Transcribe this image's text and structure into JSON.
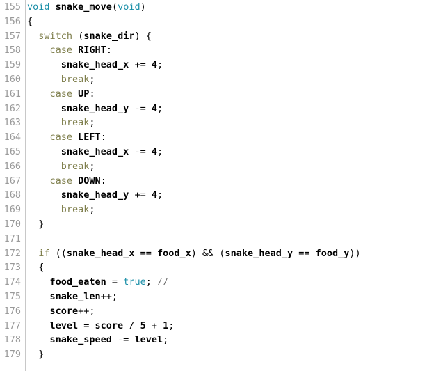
{
  "editor": {
    "language": "c",
    "background_color": "#ffffff",
    "gutter_rule_color": "#c8c8c8",
    "line_number_color": "#9a9a9a",
    "first_line_number": 155,
    "last_line_number": 179,
    "colors": {
      "keyword": "#7f7f4d",
      "type": "#1a8fa8",
      "plain": "#000000",
      "comment": "#6e6e6e"
    }
  },
  "lines": [
    {
      "number": "155",
      "tokens": [
        {
          "t": "void",
          "c": "tok-type"
        },
        {
          "t": " ",
          "c": "tok-punct"
        },
        {
          "t": "snake_move",
          "c": "tok-plain"
        },
        {
          "t": "(",
          "c": "tok-punct"
        },
        {
          "t": "void",
          "c": "tok-type"
        },
        {
          "t": ")",
          "c": "tok-punct"
        }
      ]
    },
    {
      "number": "156",
      "tokens": [
        {
          "t": "{",
          "c": "tok-punct"
        }
      ]
    },
    {
      "number": "157",
      "tokens": [
        {
          "t": "  ",
          "c": "tok-punct"
        },
        {
          "t": "switch",
          "c": "tok-keyword"
        },
        {
          "t": " ",
          "c": "tok-punct"
        },
        {
          "t": "(",
          "c": "tok-punct"
        },
        {
          "t": "snake_dir",
          "c": "tok-plain"
        },
        {
          "t": ") {",
          "c": "tok-punct"
        }
      ]
    },
    {
      "number": "158",
      "tokens": [
        {
          "t": "    ",
          "c": "tok-punct"
        },
        {
          "t": "case",
          "c": "tok-keyword"
        },
        {
          "t": " ",
          "c": "tok-punct"
        },
        {
          "t": "RIGHT",
          "c": "tok-plain"
        },
        {
          "t": ":",
          "c": "tok-punct"
        }
      ]
    },
    {
      "number": "159",
      "tokens": [
        {
          "t": "      ",
          "c": "tok-punct"
        },
        {
          "t": "snake_head_x",
          "c": "tok-plain"
        },
        {
          "t": " ",
          "c": "tok-punct"
        },
        {
          "t": "+=",
          "c": "tok-punct"
        },
        {
          "t": " ",
          "c": "tok-punct"
        },
        {
          "t": "4",
          "c": "tok-number"
        },
        {
          "t": ";",
          "c": "tok-punct"
        }
      ]
    },
    {
      "number": "160",
      "tokens": [
        {
          "t": "      ",
          "c": "tok-punct"
        },
        {
          "t": "break",
          "c": "tok-keyword"
        },
        {
          "t": ";",
          "c": "tok-punct"
        }
      ]
    },
    {
      "number": "161",
      "tokens": [
        {
          "t": "    ",
          "c": "tok-punct"
        },
        {
          "t": "case",
          "c": "tok-keyword"
        },
        {
          "t": " ",
          "c": "tok-punct"
        },
        {
          "t": "UP",
          "c": "tok-plain"
        },
        {
          "t": ":",
          "c": "tok-punct"
        }
      ]
    },
    {
      "number": "162",
      "tokens": [
        {
          "t": "      ",
          "c": "tok-punct"
        },
        {
          "t": "snake_head_y",
          "c": "tok-plain"
        },
        {
          "t": " ",
          "c": "tok-punct"
        },
        {
          "t": "-=",
          "c": "tok-punct"
        },
        {
          "t": " ",
          "c": "tok-punct"
        },
        {
          "t": "4",
          "c": "tok-number"
        },
        {
          "t": ";",
          "c": "tok-punct"
        }
      ]
    },
    {
      "number": "163",
      "tokens": [
        {
          "t": "      ",
          "c": "tok-punct"
        },
        {
          "t": "break",
          "c": "tok-keyword"
        },
        {
          "t": ";",
          "c": "tok-punct"
        }
      ]
    },
    {
      "number": "164",
      "tokens": [
        {
          "t": "    ",
          "c": "tok-punct"
        },
        {
          "t": "case",
          "c": "tok-keyword"
        },
        {
          "t": " ",
          "c": "tok-punct"
        },
        {
          "t": "LEFT",
          "c": "tok-plain"
        },
        {
          "t": ":",
          "c": "tok-punct"
        }
      ]
    },
    {
      "number": "165",
      "tokens": [
        {
          "t": "      ",
          "c": "tok-punct"
        },
        {
          "t": "snake_head_x",
          "c": "tok-plain"
        },
        {
          "t": " ",
          "c": "tok-punct"
        },
        {
          "t": "-=",
          "c": "tok-punct"
        },
        {
          "t": " ",
          "c": "tok-punct"
        },
        {
          "t": "4",
          "c": "tok-number"
        },
        {
          "t": ";",
          "c": "tok-punct"
        }
      ]
    },
    {
      "number": "166",
      "tokens": [
        {
          "t": "      ",
          "c": "tok-punct"
        },
        {
          "t": "break",
          "c": "tok-keyword"
        },
        {
          "t": ";",
          "c": "tok-punct"
        }
      ]
    },
    {
      "number": "167",
      "tokens": [
        {
          "t": "    ",
          "c": "tok-punct"
        },
        {
          "t": "case",
          "c": "tok-keyword"
        },
        {
          "t": " ",
          "c": "tok-punct"
        },
        {
          "t": "DOWN",
          "c": "tok-plain"
        },
        {
          "t": ":",
          "c": "tok-punct"
        }
      ]
    },
    {
      "number": "168",
      "tokens": [
        {
          "t": "      ",
          "c": "tok-punct"
        },
        {
          "t": "snake_head_y",
          "c": "tok-plain"
        },
        {
          "t": " ",
          "c": "tok-punct"
        },
        {
          "t": "+=",
          "c": "tok-punct"
        },
        {
          "t": " ",
          "c": "tok-punct"
        },
        {
          "t": "4",
          "c": "tok-number"
        },
        {
          "t": ";",
          "c": "tok-punct"
        }
      ]
    },
    {
      "number": "169",
      "tokens": [
        {
          "t": "      ",
          "c": "tok-punct"
        },
        {
          "t": "break",
          "c": "tok-keyword"
        },
        {
          "t": ";",
          "c": "tok-punct"
        }
      ]
    },
    {
      "number": "170",
      "tokens": [
        {
          "t": "  }",
          "c": "tok-punct"
        }
      ]
    },
    {
      "number": "171",
      "tokens": []
    },
    {
      "number": "172",
      "tokens": [
        {
          "t": "  ",
          "c": "tok-punct"
        },
        {
          "t": "if",
          "c": "tok-keyword"
        },
        {
          "t": " ((",
          "c": "tok-punct"
        },
        {
          "t": "snake_head_x",
          "c": "tok-plain"
        },
        {
          "t": " == ",
          "c": "tok-punct"
        },
        {
          "t": "food_x",
          "c": "tok-plain"
        },
        {
          "t": ") && (",
          "c": "tok-punct"
        },
        {
          "t": "snake_head_y",
          "c": "tok-plain"
        },
        {
          "t": " == ",
          "c": "tok-punct"
        },
        {
          "t": "food_y",
          "c": "tok-plain"
        },
        {
          "t": "))",
          "c": "tok-punct"
        }
      ]
    },
    {
      "number": "173",
      "tokens": [
        {
          "t": "  {",
          "c": "tok-punct"
        }
      ]
    },
    {
      "number": "174",
      "tokens": [
        {
          "t": "    ",
          "c": "tok-punct"
        },
        {
          "t": "food_eaten",
          "c": "tok-plain"
        },
        {
          "t": " = ",
          "c": "tok-punct"
        },
        {
          "t": "true",
          "c": "tok-type"
        },
        {
          "t": "; ",
          "c": "tok-punct"
        },
        {
          "t": "//",
          "c": "tok-comment"
        }
      ]
    },
    {
      "number": "175",
      "tokens": [
        {
          "t": "    ",
          "c": "tok-punct"
        },
        {
          "t": "snake_len",
          "c": "tok-plain"
        },
        {
          "t": "++;",
          "c": "tok-punct"
        }
      ]
    },
    {
      "number": "176",
      "tokens": [
        {
          "t": "    ",
          "c": "tok-punct"
        },
        {
          "t": "score",
          "c": "tok-plain"
        },
        {
          "t": "++;",
          "c": "tok-punct"
        }
      ]
    },
    {
      "number": "177",
      "tokens": [
        {
          "t": "    ",
          "c": "tok-punct"
        },
        {
          "t": "level",
          "c": "tok-plain"
        },
        {
          "t": " = ",
          "c": "tok-punct"
        },
        {
          "t": "score",
          "c": "tok-plain"
        },
        {
          "t": " / ",
          "c": "tok-punct"
        },
        {
          "t": "5",
          "c": "tok-number"
        },
        {
          "t": " + ",
          "c": "tok-punct"
        },
        {
          "t": "1",
          "c": "tok-number"
        },
        {
          "t": ";",
          "c": "tok-punct"
        }
      ]
    },
    {
      "number": "178",
      "tokens": [
        {
          "t": "    ",
          "c": "tok-punct"
        },
        {
          "t": "snake_speed",
          "c": "tok-plain"
        },
        {
          "t": " -= ",
          "c": "tok-punct"
        },
        {
          "t": "level",
          "c": "tok-plain"
        },
        {
          "t": ";",
          "c": "tok-punct"
        }
      ]
    },
    {
      "number": "179",
      "tokens": [
        {
          "t": "  }",
          "c": "tok-punct"
        }
      ]
    }
  ]
}
